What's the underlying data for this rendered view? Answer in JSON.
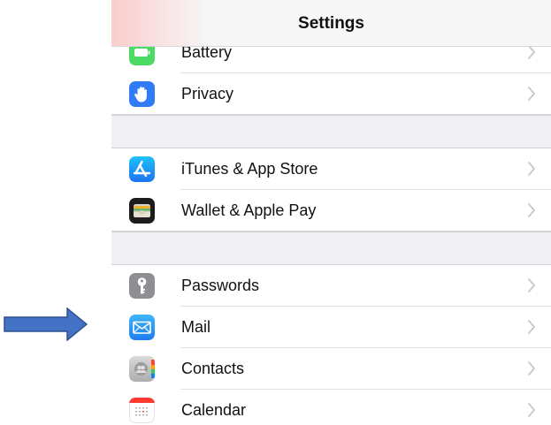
{
  "navbar": {
    "title": "Settings"
  },
  "items": [
    {
      "label": "Battery",
      "icon": "battery-icon",
      "color": "#4cd964"
    },
    {
      "label": "Privacy",
      "icon": "hand-icon",
      "color": "#2f7cf6"
    },
    {
      "label": "iTunes & App Store",
      "icon": "app-store-icon",
      "color": "#1d8cf8"
    },
    {
      "label": "Wallet & Apple Pay",
      "icon": "wallet-icon",
      "color": "#1c1c1e"
    },
    {
      "label": "Passwords",
      "icon": "key-icon",
      "color": "#8e8e93"
    },
    {
      "label": "Mail",
      "icon": "mail-icon",
      "color": "#2a8ff7"
    },
    {
      "label": "Contacts",
      "icon": "contacts-icon",
      "color": "#bdbdbd"
    },
    {
      "label": "Calendar",
      "icon": "calendar-icon",
      "color": "#ff3b30"
    }
  ],
  "annotation": {
    "icon": "arrow-right-icon",
    "color": "#4472c4",
    "target": "Mail"
  },
  "colors": {
    "group_gap": "#efeff4",
    "chevron": "#c7c7cc",
    "separator": "#e2e2e6"
  }
}
